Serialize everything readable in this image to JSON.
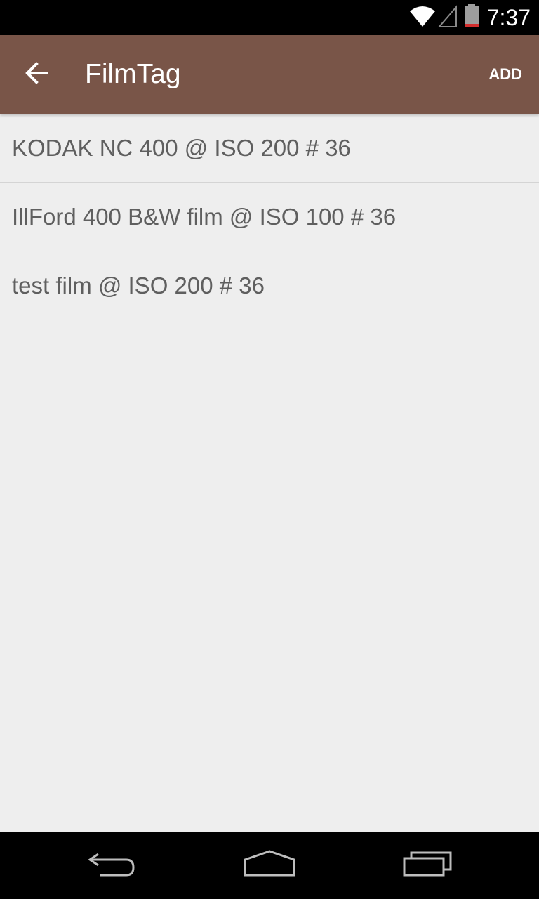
{
  "status_bar": {
    "time": "7:37",
    "icons": [
      "wifi-icon",
      "cell-signal-icon",
      "battery-icon"
    ]
  },
  "app_bar": {
    "title": "FilmTag",
    "back_icon": "arrow-back-icon",
    "action_label": "ADD",
    "color": "#795548"
  },
  "films": [
    {
      "label": "KODAK NC 400 @ ISO 200 # 36"
    },
    {
      "label": "IllFord 400 B&W film @ ISO 100 # 36"
    },
    {
      "label": "test film @ ISO 200 # 36"
    }
  ],
  "nav_bar": {
    "buttons": [
      "back-icon",
      "home-icon",
      "recents-icon"
    ]
  }
}
